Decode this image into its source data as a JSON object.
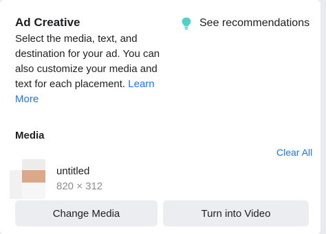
{
  "section": {
    "title": "Ad Creative",
    "recommendations_label": "See recommendations",
    "recommendations_icon": "lightbulb-icon",
    "description": "Select the media, text, and destination for your ad. You can also customize your media and text for each placement.",
    "learn_more_label": "Learn More"
  },
  "media": {
    "heading": "Media",
    "clear_all_label": "Clear All",
    "file_name": "untitled",
    "file_dimensions": "820 × 312",
    "change_media_label": "Change Media",
    "turn_into_video_label": "Turn into Video"
  },
  "colors": {
    "link": "#1877f2",
    "bulb": "#4fd1c5",
    "button_bg": "#ebedf0",
    "text": "#1c1e21",
    "muted": "#8a8d91"
  }
}
